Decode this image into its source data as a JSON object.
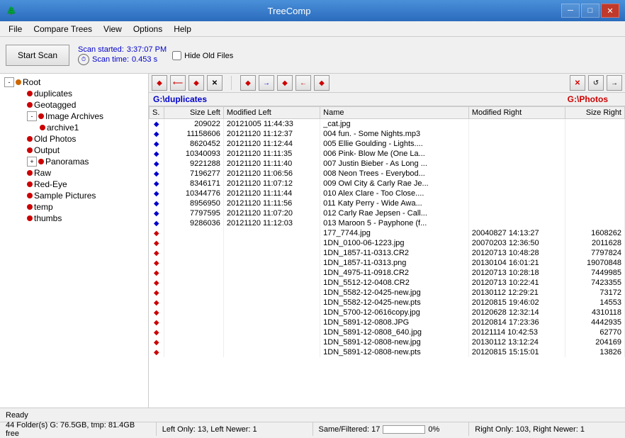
{
  "titleBar": {
    "title": "TreeComp",
    "icon": "🌲",
    "minimize": "─",
    "maximize": "□",
    "close": "✕"
  },
  "menuBar": {
    "items": [
      "File",
      "Compare Trees",
      "View",
      "Options",
      "Help"
    ]
  },
  "toolbar": {
    "scanButton": "Start Scan",
    "scanStarted": "Scan started:",
    "scanStartTime": "3:37:07 PM",
    "scanTimeLabel": "Scan time:",
    "scanTimeValue": "0.453 s",
    "hideOldFiles": "Hide Old Files"
  },
  "leftPanel": {
    "tree": [
      {
        "label": "Root",
        "level": 0,
        "type": "expand",
        "icon": "dot-orange"
      },
      {
        "label": "duplicates",
        "level": 1,
        "type": "leaf",
        "icon": "dot-red"
      },
      {
        "label": "Geotagged",
        "level": 1,
        "type": "leaf",
        "icon": "dot-red"
      },
      {
        "label": "Image Archives",
        "level": 1,
        "type": "expand",
        "icon": "dot-red"
      },
      {
        "label": "archive1",
        "level": 2,
        "type": "leaf",
        "icon": "dot-red"
      },
      {
        "label": "Old Photos",
        "level": 1,
        "type": "leaf",
        "icon": "dot-red"
      },
      {
        "label": "Output",
        "level": 1,
        "type": "leaf",
        "icon": "dot-red"
      },
      {
        "label": "Panoramas",
        "level": 1,
        "type": "expand",
        "icon": "dot-red"
      },
      {
        "label": "Raw",
        "level": 1,
        "type": "leaf",
        "icon": "dot-red"
      },
      {
        "label": "Red-Eye",
        "level": 1,
        "type": "leaf",
        "icon": "dot-red"
      },
      {
        "label": "Sample Pictures",
        "level": 1,
        "type": "leaf",
        "icon": "dot-red"
      },
      {
        "label": "temp",
        "level": 1,
        "type": "leaf",
        "icon": "dot-red"
      },
      {
        "label": "thumbs",
        "level": 1,
        "type": "leaf",
        "icon": "dot-red"
      }
    ]
  },
  "pathBars": {
    "leftPath": "G:\\duplicates",
    "rightPath": "G:\\Photos"
  },
  "tableHeaders": [
    "S.",
    "Size Left",
    "Modified Left",
    "Name",
    "Modified Right",
    "Size Right"
  ],
  "tableRows": [
    {
      "indicator": "blue-diamond",
      "sizeLeft": "209022",
      "modLeft": "20121005 11:44:33",
      "name": "_cat.jpg",
      "modRight": "",
      "sizeRight": ""
    },
    {
      "indicator": "blue-diamond",
      "sizeLeft": "11158606",
      "modLeft": "20121120 11:12:37",
      "name": "004 fun. - Some Nights.mp3",
      "modRight": "",
      "sizeRight": ""
    },
    {
      "indicator": "blue-diamond",
      "sizeLeft": "8620452",
      "modLeft": "20121120 11:12:44",
      "name": "005 Ellie Goulding - Lights....",
      "modRight": "",
      "sizeRight": ""
    },
    {
      "indicator": "blue-diamond",
      "sizeLeft": "10340093",
      "modLeft": "20121120 11:11:35",
      "name": "006 Pink- Blow Me (One La...",
      "modRight": "",
      "sizeRight": ""
    },
    {
      "indicator": "blue-diamond",
      "sizeLeft": "9221288",
      "modLeft": "20121120 11:11:40",
      "name": "007 Justin Bieber - As Long ...",
      "modRight": "",
      "sizeRight": ""
    },
    {
      "indicator": "blue-diamond",
      "sizeLeft": "7196277",
      "modLeft": "20121120 11:06:56",
      "name": "008 Neon Trees - Everybod...",
      "modRight": "",
      "sizeRight": ""
    },
    {
      "indicator": "blue-diamond",
      "sizeLeft": "8346171",
      "modLeft": "20121120 11:07:12",
      "name": "009 Owl City & Carly Rae Je...",
      "modRight": "",
      "sizeRight": ""
    },
    {
      "indicator": "blue-diamond",
      "sizeLeft": "10344776",
      "modLeft": "20121120 11:11:44",
      "name": "010 Alex Clare - Too Close....",
      "modRight": "",
      "sizeRight": ""
    },
    {
      "indicator": "blue-diamond",
      "sizeLeft": "8956950",
      "modLeft": "20121120 11:11:56",
      "name": "011 Katy Perry - Wide Awa...",
      "modRight": "",
      "sizeRight": ""
    },
    {
      "indicator": "blue-diamond",
      "sizeLeft": "7797595",
      "modLeft": "20121120 11:07:20",
      "name": "012 Carly Rae Jepsen - Call...",
      "modRight": "",
      "sizeRight": ""
    },
    {
      "indicator": "blue-diamond",
      "sizeLeft": "9286036",
      "modLeft": "20121120 11:12:03",
      "name": "013 Maroon 5 - Payphone (f...",
      "modRight": "",
      "sizeRight": ""
    },
    {
      "indicator": "red-diamond",
      "sizeLeft": "",
      "modLeft": "",
      "name": "177_7744.jpg",
      "modRight": "20040827 14:13:27",
      "sizeRight": "1608262"
    },
    {
      "indicator": "red-diamond",
      "sizeLeft": "",
      "modLeft": "",
      "name": "1DN_0100-06-1223.jpg",
      "modRight": "20070203 12:36:50",
      "sizeRight": "2011628"
    },
    {
      "indicator": "red-diamond",
      "sizeLeft": "",
      "modLeft": "",
      "name": "1DN_1857-11-0313.CR2",
      "modRight": "20120713 10:48:28",
      "sizeRight": "7797824"
    },
    {
      "indicator": "red-diamond",
      "sizeLeft": "",
      "modLeft": "",
      "name": "1DN_1857-11-0313.png",
      "modRight": "20130104 16:01:21",
      "sizeRight": "19070848"
    },
    {
      "indicator": "red-diamond",
      "sizeLeft": "",
      "modLeft": "",
      "name": "1DN_4975-11-0918.CR2",
      "modRight": "20120713 10:28:18",
      "sizeRight": "7449985"
    },
    {
      "indicator": "red-diamond",
      "sizeLeft": "",
      "modLeft": "",
      "name": "1DN_5512-12-0408.CR2",
      "modRight": "20120713 10:22:41",
      "sizeRight": "7423355"
    },
    {
      "indicator": "red-diamond",
      "sizeLeft": "",
      "modLeft": "",
      "name": "1DN_5582-12-0425-new.jpg",
      "modRight": "20130112 12:29:21",
      "sizeRight": "73172"
    },
    {
      "indicator": "red-diamond",
      "sizeLeft": "",
      "modLeft": "",
      "name": "1DN_5582-12-0425-new.pts",
      "modRight": "20120815 19:46:02",
      "sizeRight": "14553"
    },
    {
      "indicator": "red-diamond",
      "sizeLeft": "",
      "modLeft": "",
      "name": "1DN_5700-12-0616copy.jpg",
      "modRight": "20120628 12:32:14",
      "sizeRight": "4310118"
    },
    {
      "indicator": "red-diamond",
      "sizeLeft": "",
      "modLeft": "",
      "name": "1DN_5891-12-0808.JPG",
      "modRight": "20120814 17:23:36",
      "sizeRight": "4442935"
    },
    {
      "indicator": "red-diamond",
      "sizeLeft": "",
      "modLeft": "",
      "name": "1DN_5891-12-0808_640.jpg",
      "modRight": "20121114 10:42:53",
      "sizeRight": "62770"
    },
    {
      "indicator": "red-diamond",
      "sizeLeft": "",
      "modLeft": "",
      "name": "1DN_5891-12-0808-new.jpg",
      "modRight": "20130112 13:12:24",
      "sizeRight": "204169"
    },
    {
      "indicator": "red-diamond",
      "sizeLeft": "",
      "modLeft": "",
      "name": "1DN_5891-12-0808-new.pts",
      "modRight": "20120815 15:15:01",
      "sizeRight": "13826"
    }
  ],
  "statusBar": {
    "ready": "Ready",
    "diskInfo": "44 Folder(s) G: 76.5GB, tmp: 81.4GB free",
    "leftOnly": "Left Only: 13, Left Newer: 1",
    "sameFiltered": "Same/Filtered: 17",
    "rightOnly": "Right Only: 103, Right Newer: 1",
    "progress": "0%"
  }
}
